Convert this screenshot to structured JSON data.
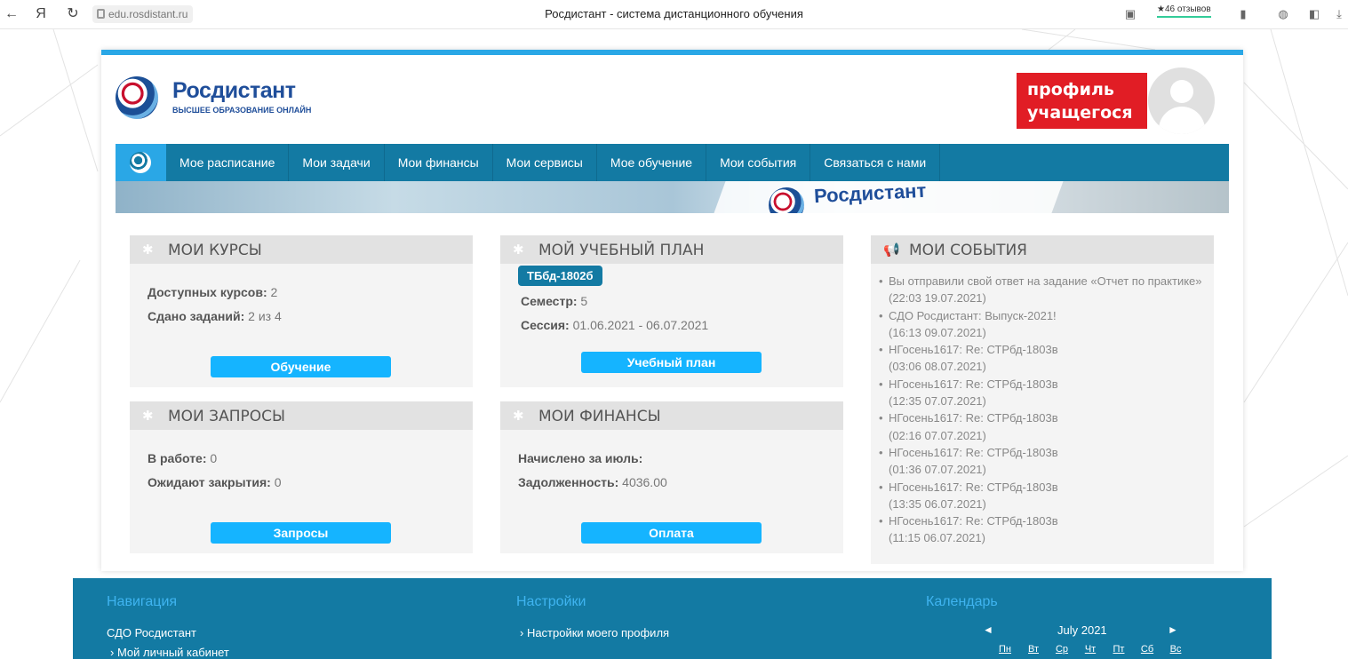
{
  "browser": {
    "url": "edu.rosdistant.ru",
    "title": "Росдистант - система дистанционного обучения",
    "reviews": "★46 отзывов"
  },
  "header": {
    "logo_name": "Росдистант",
    "logo_subtitle": "ВЫСШЕЕ ОБРАЗОВАНИЕ ОНЛАЙН",
    "profile_line1": "профиль",
    "profile_line2": "учащегося"
  },
  "menu": {
    "items": [
      {
        "label": "Мое расписание"
      },
      {
        "label": "Мои задачи"
      },
      {
        "label": "Мои финансы"
      },
      {
        "label": "Мои сервисы"
      },
      {
        "label": "Мое обучение"
      },
      {
        "label": "Мои события"
      },
      {
        "label": "Связаться с нами"
      }
    ]
  },
  "banner": {
    "text": "Росдистант"
  },
  "courses": {
    "title": "МОИ КУРСЫ",
    "available_label": "Доступных курсов:",
    "available_value": "2",
    "submitted_label": "Сдано заданий:",
    "submitted_value": "2 из 4",
    "button": "Обучение"
  },
  "plan": {
    "title": "МОЙ УЧЕБНЫЙ ПЛАН",
    "group": "ТБбд-1802б",
    "semester_label": "Семестр:",
    "semester_value": "5",
    "session_label": "Сессия:",
    "session_value": "01.06.2021 - 06.07.2021",
    "button": "Учебный план"
  },
  "requests": {
    "title": "МОИ ЗАПРОСЫ",
    "in_work_label": "В работе:",
    "in_work_value": "0",
    "awaiting_label": "Ожидают закрытия:",
    "awaiting_value": "0",
    "button": "Запросы"
  },
  "finances": {
    "title": "МОИ ФИНАНСЫ",
    "accrued_label": "Начислено за июль:",
    "debt_label": "Задолженность:",
    "debt_value": "4036.00",
    "button": "Оплата"
  },
  "events": {
    "title": "МОИ СОБЫТИЯ",
    "items": [
      {
        "text": "Вы отправили свой ответ на задание «Отчет по практике»",
        "time": "(22:03 19.07.2021)"
      },
      {
        "text": "СДО Росдистант: Выпуск-2021!",
        "time": "(16:13 09.07.2021)"
      },
      {
        "text": "НГосень1617: Re: СТРбд-1803в",
        "time": "(03:06 08.07.2021)"
      },
      {
        "text": "НГосень1617: Re: СТРбд-1803в",
        "time": "(12:35 07.07.2021)"
      },
      {
        "text": "НГосень1617: Re: СТРбд-1803в",
        "time": "(02:16 07.07.2021)"
      },
      {
        "text": "НГосень1617: Re: СТРбд-1803в",
        "time": "(01:36 07.07.2021)"
      },
      {
        "text": "НГосень1617: Re: СТРбд-1803в",
        "time": "(13:35 06.07.2021)"
      },
      {
        "text": "НГосень1617: Re: СТРбд-1803в",
        "time": "(11:15 06.07.2021)"
      }
    ]
  },
  "footer": {
    "nav_title": "Навигация",
    "nav_link1": "СДО Росдистант",
    "nav_link2": "› Мой личный кабинет",
    "settings_title": "Настройки",
    "settings_link": "› Настройки моего профиля",
    "calendar_title": "Календарь",
    "calendar_month": "July 2021",
    "calendar_prev": "◄",
    "calendar_next": "►",
    "calendar_days": [
      "Пн",
      "Вт",
      "Ср",
      "Чт",
      "Пт",
      "Сб",
      "Вс"
    ]
  },
  "colors": {
    "accent": "#2aa7e6",
    "menu": "#137aa3",
    "button": "#15b4ff",
    "profile_badge": "#e11d25"
  }
}
